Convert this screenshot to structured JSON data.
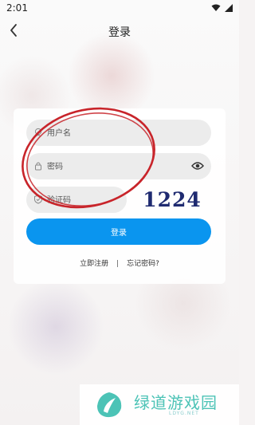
{
  "status_bar": {
    "time": "2:01",
    "icons": [
      "wifi-icon",
      "signal-icon"
    ]
  },
  "header": {
    "title": "登录",
    "back_icon": "chevron-left-icon"
  },
  "form": {
    "username_placeholder": "用户名",
    "password_placeholder": "密码",
    "captcha_placeholder": "验证码",
    "captcha_code": "1224",
    "login_label": "登录",
    "register_link": "立即注册",
    "separator": "|",
    "forgot_link": "忘记密码?"
  },
  "watermark": {
    "brand": "绿道游戏园",
    "sub": "LDYG.NET"
  },
  "colors": {
    "primary": "#0a95ef",
    "annotation_circle": "#c8242a",
    "watermark": "#4cc3b6"
  }
}
